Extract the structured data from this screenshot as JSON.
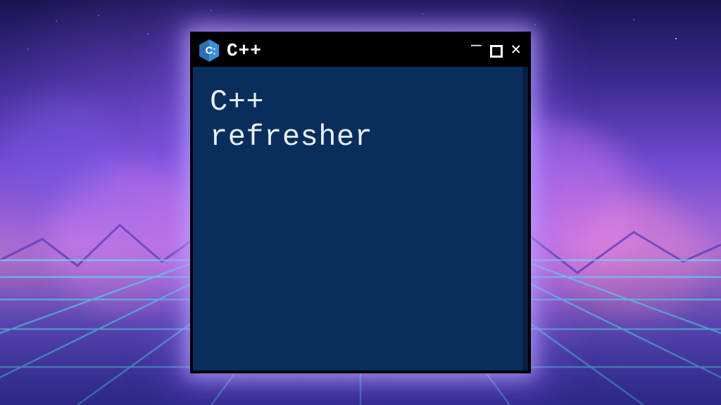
{
  "window": {
    "title": "C++",
    "icon": "cpp-logo",
    "content_lines": [
      "C++",
      "refresher"
    ],
    "colors": {
      "titlebar_bg": "#000000",
      "content_bg": "#0a2e5c",
      "text": "#e8eef6",
      "glow": "#beaaff"
    }
  }
}
